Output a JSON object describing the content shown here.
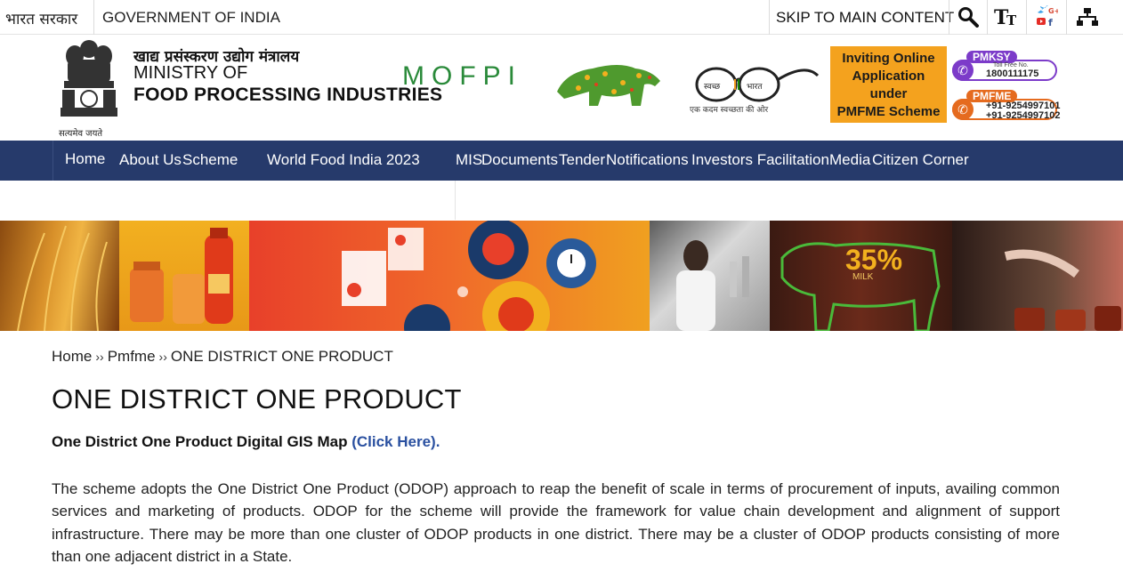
{
  "topbar": {
    "hindi_label": "भारत सरकार",
    "english_label": "GOVERNMENT OF INDIA",
    "skip_label": "SKIP TO MAIN CONTENT",
    "icons": [
      "search-icon",
      "text-size-icon",
      "social-media-icon",
      "sitemap-icon"
    ]
  },
  "header": {
    "emblem_caption": "सत्यमेव जयते",
    "ministry_hindi": "खाद्य प्रसंस्करण उद्योग मंत्रालय",
    "ministry_line1": "MINISTRY OF",
    "ministry_line2": "FOOD PROCESSING INDUSTRIES",
    "mofpi_logo": "MOFPI",
    "swachh_caption": "एक कदम स्वच्छता की ओर",
    "promo": [
      "Inviting Online",
      "Application",
      "under",
      "PMFME Scheme"
    ],
    "helplines": [
      {
        "tag": "PMKSY",
        "small": "Toll Free No.",
        "numbers": "1800111175"
      },
      {
        "tag": "PMFME",
        "numbers": "+91-9254997101\n+91-9254997102"
      }
    ]
  },
  "nav": {
    "items": [
      "Home",
      "About Us",
      "Scheme",
      "World Food India 2023",
      "MIS",
      "Documents",
      "Tender",
      "Notifications",
      "Investors Facilitation",
      "Media",
      "Citizen Corner"
    ]
  },
  "banner": {
    "stat": "35%",
    "stat_label": "MILK"
  },
  "content": {
    "breadcrumb": [
      "Home",
      "Pmfme",
      "ONE DISTRICT ONE PRODUCT"
    ],
    "breadcrumb_sep": "››",
    "title": "ONE DISTRICT ONE PRODUCT",
    "gis_text": "One District One Product Digital GIS Map ",
    "gis_link": "(Click Here).",
    "paragraph": "The scheme adopts the One District One Product (ODOP) approach to reap the benefit of scale in terms of procurement of inputs, availing common services and marketing of products. ODOP for the scheme will provide the framework for value chain development and alignment of support infrastructure. There may be more than one cluster of ODOP products in one district. There may be a cluster of ODOP products consisting of more than one adjacent district in a State."
  }
}
